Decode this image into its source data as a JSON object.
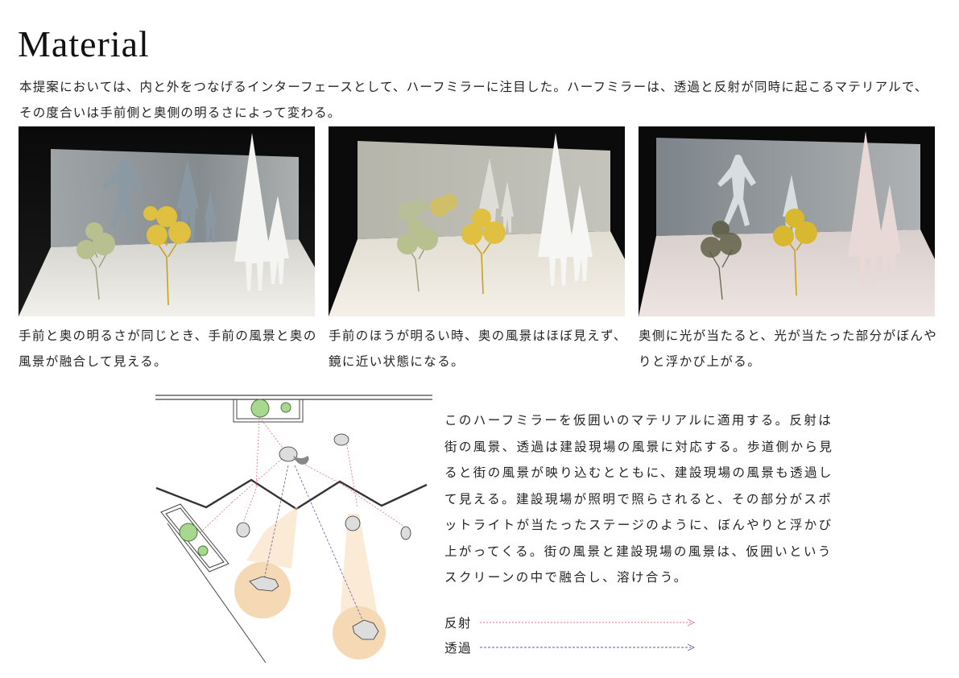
{
  "page": {
    "title": "Material",
    "intro": "本提案においては、内と外をつなげるインターフェースとして、ハーフミラーに注目した。ハーフミラーは、透過と反射が同時に起こるマテリアルで、その度合いは手前側と奥側の明るさによって変わる。"
  },
  "photos": [
    {
      "caption": "手前と奥の明るさが同じとき、手前の風景と奥の風景が融合して見える。"
    },
    {
      "caption": "手前のほうが明るい時、奥の風景はほぼ見えず、鏡に近い状態になる。"
    },
    {
      "caption": "奥側に光が当たると、光が当たった部分がぼんやりと浮かび上がる。"
    }
  ],
  "body": {
    "text": "このハーフミラーを仮囲いのマテリアルに適用する。反射は街の風景、透過は建設現場の風景に対応する。歩道側から見ると街の風景が映り込むとともに、建設現場の風景も透過して見える。建設現場が照明で照らされると、その部分がスポットライトが当たったステージのように、ぼんやりと浮かび上がってくる。街の風景と建設現場の風景は、仮囲いというスクリーンの中で融合し、溶け合う。"
  },
  "legend": {
    "reflection": {
      "label": "反射",
      "color": "#e8707a"
    },
    "transmission": {
      "label": "透過",
      "color": "#6a5a9a"
    }
  },
  "colors": {
    "accent_spotlight": "#f5d9b4",
    "tree_green": "#a8d890",
    "tree_yellow": "#d8b830"
  }
}
